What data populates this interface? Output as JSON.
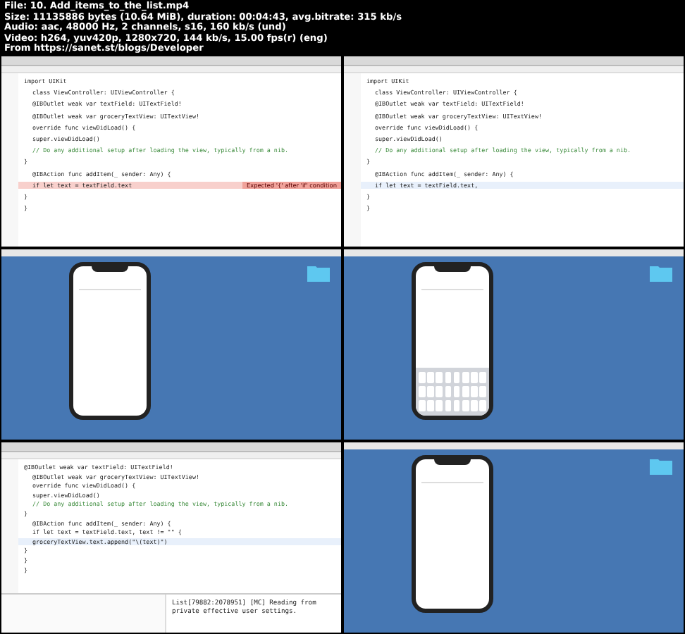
{
  "header": {
    "lines": [
      "File: 10. Add_items_to_the_list.mp4",
      "Size: 11135886 bytes (10.64 MiB), duration: 00:04:43, avg.bitrate: 315 kb/s",
      "Audio: aac, 48000 Hz, 2 channels, s16, 160 kb/s (und)",
      "Video: h264, yuv420p, 1280x720, 144 kb/s, 15.00 fps(r) (eng)",
      "From https://sanet.st/blogs/Developer"
    ]
  },
  "tiles": [
    {
      "kind": "code",
      "lines": [
        {
          "text": "import UIKit",
          "kind": "code",
          "current": false
        },
        {
          "text": "class ViewController: UIViewController {",
          "kind": "code",
          "current": false
        },
        {
          "text": "@IBOutlet weak var textField: UITextField!",
          "kind": "code",
          "current": false
        },
        {
          "text": "@IBOutlet weak var groceryTextView: UITextView!",
          "kind": "code",
          "current": false
        },
        {
          "text": "override func viewDidLoad() {",
          "kind": "code",
          "current": false
        },
        {
          "text": "super.viewDidLoad()",
          "kind": "code",
          "current": false
        },
        {
          "text": "// Do any additional setup after loading the view, typically from a nib.",
          "kind": "comment",
          "current": false
        },
        {
          "text": "}",
          "kind": "code",
          "current": false
        },
        {
          "text": "@IBAction func addItem(_ sender: Any) {",
          "kind": "code",
          "current": false
        },
        {
          "text": "if let text = textField.text",
          "kind": "code",
          "current": false,
          "error": "Expected '{' after 'if' condition"
        },
        {
          "text": "}",
          "kind": "code",
          "current": false
        },
        {
          "text": "}",
          "kind": "code",
          "current": false
        }
      ]
    },
    {
      "kind": "code",
      "lines": [
        {
          "text": "import UIKit",
          "kind": "code",
          "current": false
        },
        {
          "text": "class ViewController: UIViewController {",
          "kind": "code",
          "current": false
        },
        {
          "text": "@IBOutlet weak var textField: UITextField!",
          "kind": "code",
          "current": false
        },
        {
          "text": "@IBOutlet weak var groceryTextView: UITextView!",
          "kind": "code",
          "current": false
        },
        {
          "text": "override func viewDidLoad() {",
          "kind": "code",
          "current": false
        },
        {
          "text": "super.viewDidLoad()",
          "kind": "code",
          "current": false
        },
        {
          "text": "// Do any additional setup after loading the view, typically from a nib.",
          "kind": "comment",
          "current": false
        },
        {
          "text": "}",
          "kind": "code",
          "current": false
        },
        {
          "text": "@IBAction func addItem(_ sender: Any) {",
          "kind": "code",
          "current": false
        },
        {
          "text": "if let text = textField.text,",
          "kind": "code",
          "current": true
        },
        {
          "text": "}",
          "kind": "code",
          "current": false
        },
        {
          "text": "}",
          "kind": "code",
          "current": false
        }
      ]
    },
    {
      "kind": "simulator",
      "keyboard": false
    },
    {
      "kind": "simulator",
      "keyboard": true
    },
    {
      "kind": "code",
      "lines": [
        {
          "text": "@IBOutlet weak var textField: UITextField!",
          "kind": "code",
          "current": false
        },
        {
          "text": "@IBOutlet weak var groceryTextView: UITextView!",
          "kind": "code",
          "current": false
        },
        {
          "text": "override func viewDidLoad() {",
          "kind": "code",
          "current": false
        },
        {
          "text": "super.viewDidLoad()",
          "kind": "code",
          "current": false
        },
        {
          "text": "// Do any additional setup after loading the view, typically from a nib.",
          "kind": "comment",
          "current": false
        },
        {
          "text": "}",
          "kind": "code",
          "current": false
        },
        {
          "text": "@IBAction func addItem(_ sender: Any) {",
          "kind": "code",
          "current": false
        },
        {
          "text": "if let text = textField.text, text != \"\" {",
          "kind": "code",
          "current": false
        },
        {
          "text": "groceryTextView.text.append(\"\\(text)\")",
          "kind": "code",
          "current": true
        },
        {
          "text": "}",
          "kind": "code",
          "current": false
        },
        {
          "text": "}",
          "kind": "code",
          "current": false
        },
        {
          "text": "}",
          "kind": "code",
          "current": false
        }
      ],
      "console": "List[79882:2078951] [MC] Reading from private effective user settings."
    },
    {
      "kind": "simulator",
      "keyboard": false
    }
  ]
}
